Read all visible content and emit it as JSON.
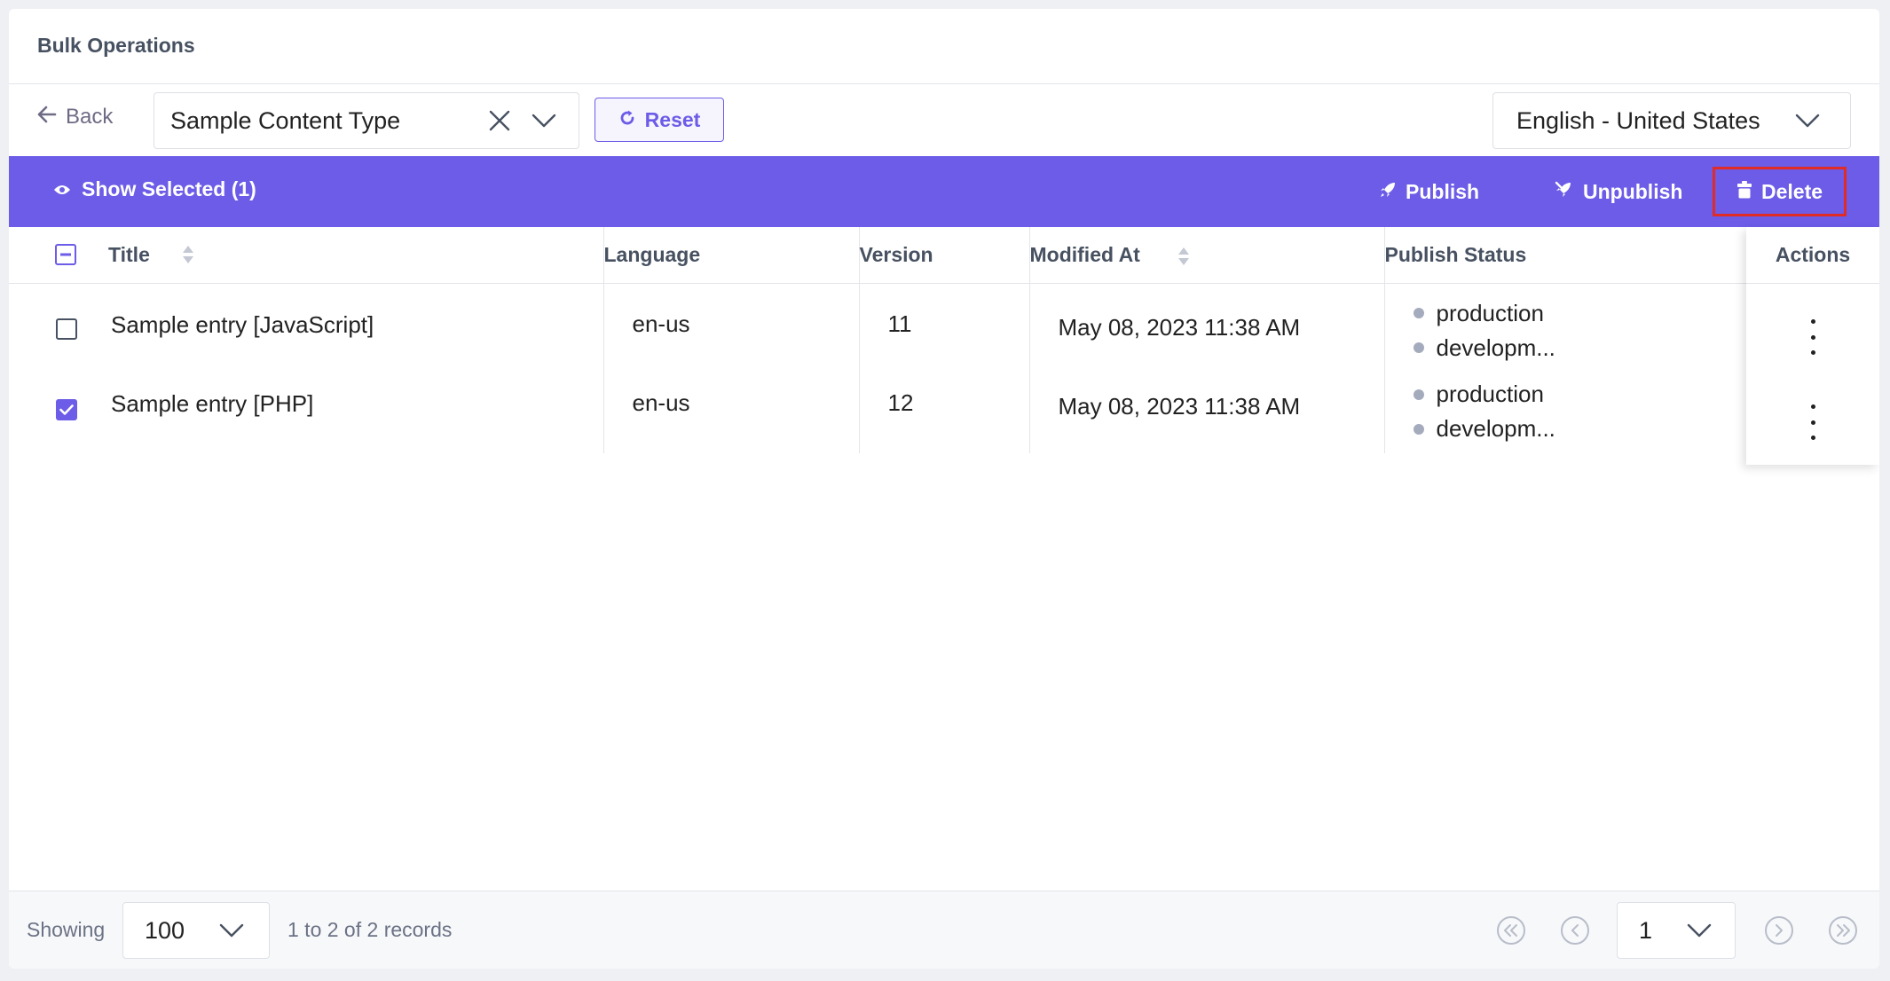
{
  "header": {
    "title": "Bulk Operations"
  },
  "toolbar": {
    "back_label": "Back",
    "content_type": "Sample Content Type",
    "reset_label": "Reset",
    "locale": "English - United States"
  },
  "action_bar": {
    "show_selected_label": "Show Selected (1)",
    "publish_label": "Publish",
    "unpublish_label": "Unpublish",
    "delete_label": "Delete"
  },
  "table": {
    "columns": {
      "title": "Title",
      "language": "Language",
      "version": "Version",
      "modified_at": "Modified At",
      "publish_status": "Publish Status",
      "actions": "Actions"
    },
    "rows": [
      {
        "checked": false,
        "title": "Sample entry [JavaScript]",
        "language": "en-us",
        "version": "11",
        "modified_at": "May 08, 2023 11:38 AM",
        "status": [
          "production",
          "developm..."
        ]
      },
      {
        "checked": true,
        "title": "Sample entry [PHP]",
        "language": "en-us",
        "version": "12",
        "modified_at": "May 08, 2023 11:38 AM",
        "status": [
          "production",
          "developm..."
        ]
      }
    ]
  },
  "footer": {
    "showing_label": "Showing",
    "page_size": "100",
    "records_label": "1 to 2 of 2 records",
    "current_page": "1"
  },
  "colors": {
    "accent": "#6c5ce7",
    "delete_outline": "#e02b26",
    "status_dot": "#a4abbd"
  }
}
